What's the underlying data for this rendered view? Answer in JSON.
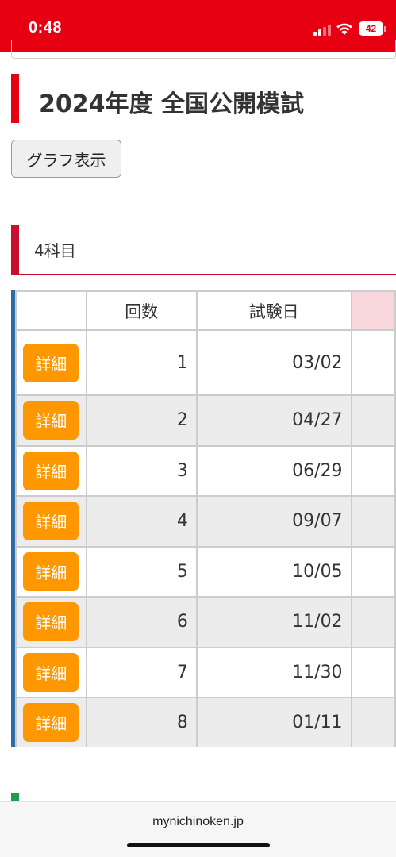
{
  "status_bar": {
    "time": "0:48",
    "battery": "42",
    "background": "#e60012"
  },
  "header": {
    "title": "2024年度 全国公開模試",
    "accent": "#e60012"
  },
  "graph_button_label": "グラフ表示",
  "section": {
    "label": "4科目",
    "accent": "#c8102e"
  },
  "table": {
    "columns": [
      "",
      "回数",
      "試験日",
      ""
    ],
    "detail_label": "詳細",
    "rows": [
      {
        "count": "1",
        "date": "03/02"
      },
      {
        "count": "2",
        "date": "04/27"
      },
      {
        "count": "3",
        "date": "06/29"
      },
      {
        "count": "4",
        "date": "09/07"
      },
      {
        "count": "5",
        "date": "10/05"
      },
      {
        "count": "6",
        "date": "11/02"
      },
      {
        "count": "7",
        "date": "11/30"
      },
      {
        "count": "8",
        "date": "01/11"
      }
    ],
    "button_color": "#ff9800",
    "border_accent": "#2e6ca4"
  },
  "browser": {
    "url": "mynichinoken.jp"
  }
}
